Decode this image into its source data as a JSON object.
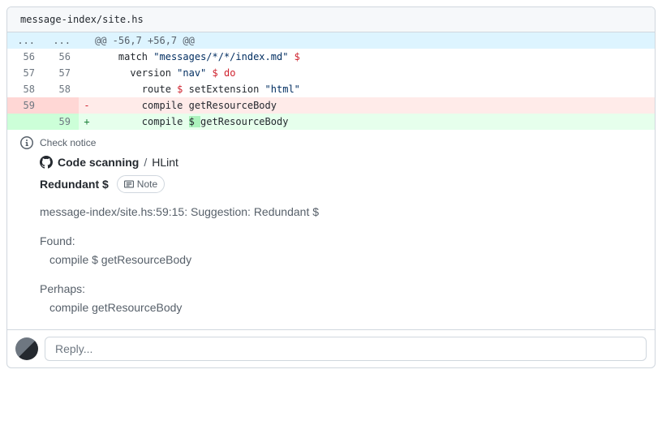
{
  "file_path": "message-index/site.hs",
  "hunk_header": "@@ -56,7 +56,7 @@",
  "lines": [
    {
      "old": "56",
      "new": "56",
      "type": "ctx",
      "sign": " ",
      "indent": "    ",
      "segs": [
        {
          "t": "match ",
          "c": "pl-en"
        },
        {
          "t": "\"messages/*/*/index.md\"",
          "c": "pl-s"
        },
        {
          "t": " ",
          "c": ""
        },
        {
          "t": "$",
          "c": "pl-k"
        }
      ]
    },
    {
      "old": "57",
      "new": "57",
      "type": "ctx",
      "sign": " ",
      "indent": "      ",
      "segs": [
        {
          "t": "version ",
          "c": "pl-en"
        },
        {
          "t": "\"nav\"",
          "c": "pl-s"
        },
        {
          "t": " ",
          "c": ""
        },
        {
          "t": "$",
          "c": "pl-k"
        },
        {
          "t": " ",
          "c": ""
        },
        {
          "t": "do",
          "c": "pl-k"
        }
      ]
    },
    {
      "old": "58",
      "new": "58",
      "type": "ctx",
      "sign": " ",
      "indent": "        ",
      "segs": [
        {
          "t": "route ",
          "c": "pl-en"
        },
        {
          "t": "$",
          "c": "pl-k"
        },
        {
          "t": " setExtension ",
          "c": "pl-en"
        },
        {
          "t": "\"html\"",
          "c": "pl-s"
        }
      ]
    },
    {
      "old": "59",
      "new": "",
      "type": "del",
      "sign": "-",
      "indent": "        ",
      "segs": [
        {
          "t": "compile getResourceBody",
          "c": "pl-en"
        }
      ]
    },
    {
      "old": "",
      "new": "59",
      "type": "add",
      "sign": "+",
      "indent": "        ",
      "segs": [
        {
          "t": "compile ",
          "c": "pl-en"
        },
        {
          "t": "$ ",
          "c": "hl-add"
        },
        {
          "t": "getResourceBody",
          "c": "pl-en"
        }
      ]
    }
  ],
  "notice": {
    "label": "Check notice",
    "scanner": "Code scanning",
    "tool": "HLint",
    "title": "Redundant $",
    "severity": "Note",
    "message": "message-index/site.hs:59:15: Suggestion: Redundant $",
    "found_label": "Found:",
    "found_code": "compile $ getResourceBody",
    "perhaps_label": "Perhaps:",
    "perhaps_code": "compile getResourceBody"
  },
  "reply_placeholder": "Reply..."
}
